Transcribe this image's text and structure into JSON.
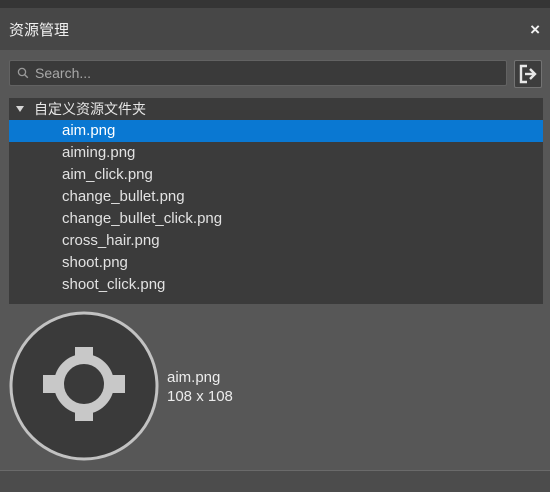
{
  "window": {
    "title": "资源管理",
    "close_glyph": "×"
  },
  "search": {
    "placeholder": "Search...",
    "value": "",
    "icon": "search-icon"
  },
  "toolbar": {
    "export_icon": "export-icon"
  },
  "tree": {
    "folder": "自定义资源文件夹",
    "items": [
      "aim.png",
      "aiming.png",
      "aim_click.png",
      "change_bullet.png",
      "change_bullet_click.png",
      "cross_hair.png",
      "shoot.png",
      "shoot_click.png"
    ],
    "selected_index": 0
  },
  "preview": {
    "filename": "aim.png",
    "dimensions": "108 x 108"
  },
  "colors": {
    "selection": "#0a78d2",
    "panel": "#3b3b3b",
    "background": "#575757"
  }
}
